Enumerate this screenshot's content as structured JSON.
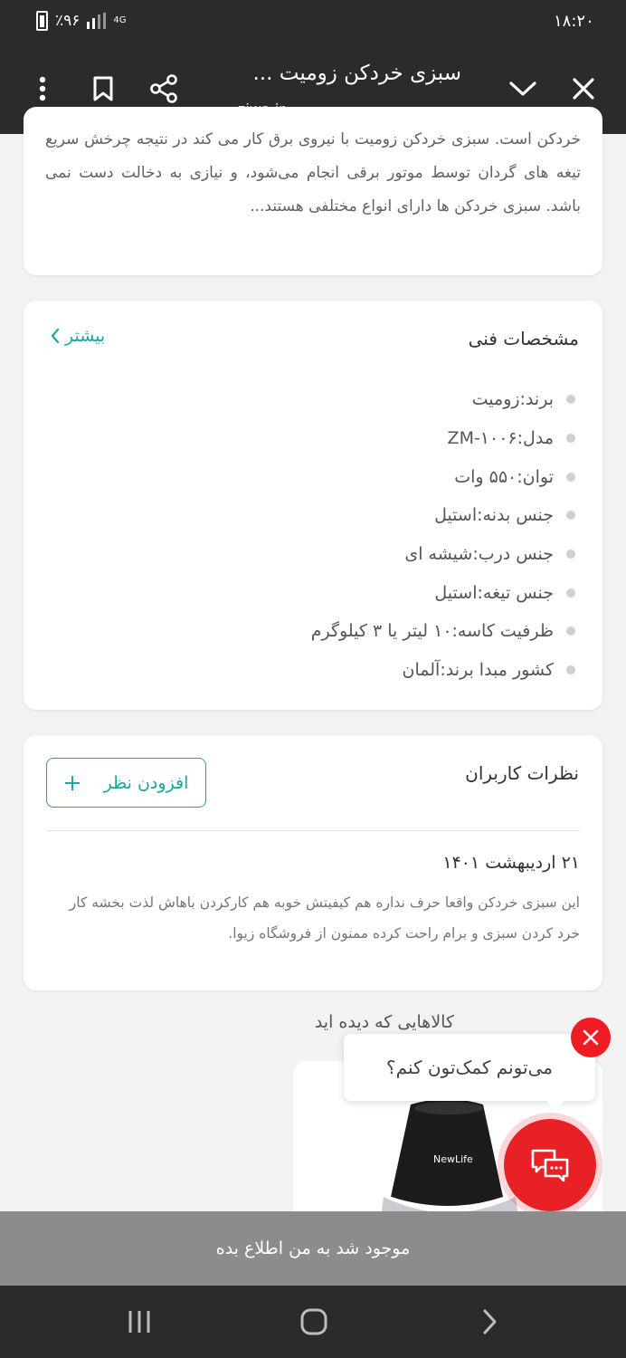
{
  "status": {
    "time": "۱۸:۲۰",
    "battery": "٪۹۶",
    "network": "4G"
  },
  "browser": {
    "title": "سبزی خردکن زومیت ...",
    "url": "ziwa.ir"
  },
  "description": {
    "text": "خردکن است. سبزی خردکن زومیت با نیروی برق کار می کند در نتیجه چرخش سریع تیغه های گردان توسط موتور برقی انجام می‌شود، و نیازی به دخالت دست نمی باشد. سبزی خردکن ها دارای انواع مختلفی هستند..."
  },
  "specs": {
    "title": "مشخصات فنی",
    "more_label": "بیشتر",
    "items": [
      "برند:زومیت",
      "مدل:ZM-۱۰۰۶",
      "توان:۵۵۰ وات",
      "جنس بدنه:استیل",
      "جنس درب:شیشه ای",
      "جنس تیغه:استیل",
      "ظرفیت کاسه:۱۰ لیتر یا ۳ کیلوگرم",
      "کشور مبدا برند:آلمان"
    ]
  },
  "reviews": {
    "title": "نظرات کاربران",
    "add_label": "افزودن نظر",
    "items": [
      {
        "date": "۲۱ اردیبهشت ۱۴۰۱",
        "text": "این سبزی خردکن واقعا حرف نداره هم کیفیتش خوبه هم کارکردن باهاش لذت بخشه کار خرد کردن سبزی و برام راحت کرده ممنون از فروشگاه زیوا."
      }
    ]
  },
  "similar": {
    "title": "کالاهایی که دیده اید",
    "product_brand": "NewLife"
  },
  "chat": {
    "prompt": "می‌تونم کمک‌تون کنم؟"
  },
  "notify": {
    "label": "موجود شد به من اطلاع بده"
  },
  "colors": {
    "accent": "#1aa79e",
    "chat": "#e82127",
    "bar": "#2b2b2b"
  }
}
